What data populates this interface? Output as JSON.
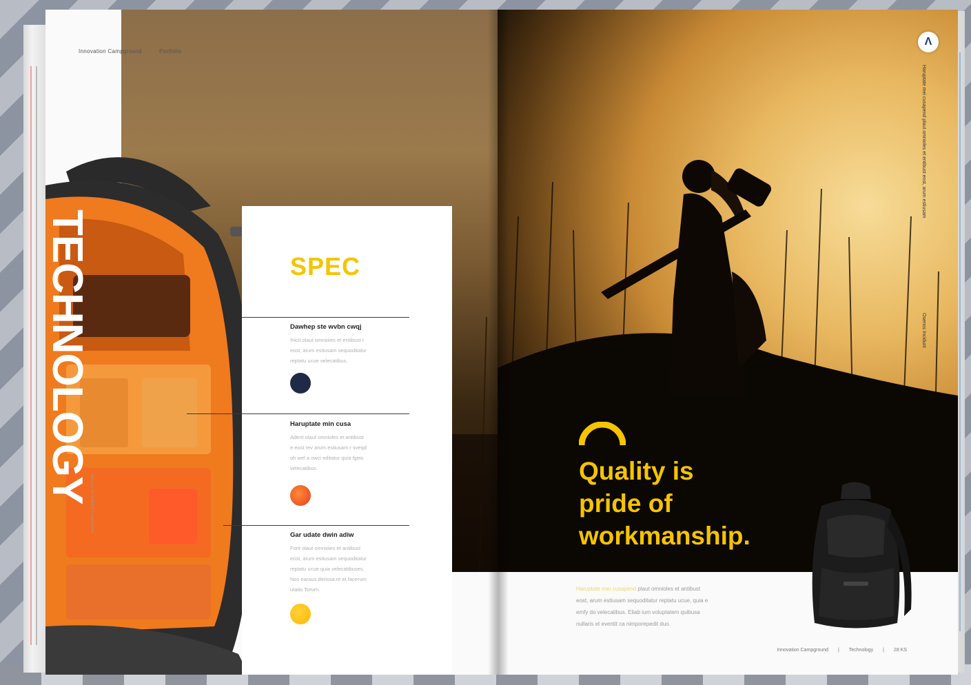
{
  "colors": {
    "accent": "#f5c400",
    "swatches": [
      "#1f2b46",
      "#f04a1a",
      "#ffc400"
    ],
    "backpack_orange": "#f07a1e"
  },
  "left_page": {
    "header": [
      "Innovation Campground",
      "Portfolio"
    ],
    "vertical_word": "TECHNOLOGY",
    "side_caption": "Innovation Campground Portfolio",
    "spec": {
      "title": "SPEC",
      "items": [
        {
          "heading": "Dawhep ste wvbn cwqj",
          "lines": [
            "Ihicit olaut omnioles et entibust t",
            "eost, arum estiusam sequoditatur",
            "reptatu ucue velecatibus."
          ],
          "swatch": "navy"
        },
        {
          "heading": "Haruptate min cusa",
          "lines": [
            "Adent olaut omnioles et antibust",
            "e eost rev arum estiusam r sveqd",
            "oh wel a owci editatur quia fgeis",
            "velecatibus."
          ],
          "swatch": "red-orange"
        },
        {
          "heading": "Gar udate dwin adiw",
          "lines": [
            "Forit olaut omnioles et antibust",
            "eost, arum estiusam sequoditatur",
            "reptatu ucue quia velecatibuses.",
            "Nos earaus derissa re et facerum",
            "utatio Torum."
          ],
          "swatch": "yellow"
        }
      ]
    }
  },
  "right_page": {
    "logo": "Λ",
    "vertical_text": "Haruptate mei cusapend plaut omnioles et entibust eost, arum estiusam",
    "vertical_label": "Osenos Incidunt",
    "headline": [
      "Quality is",
      "pride of",
      "workmanship."
    ],
    "body": {
      "lead": "Haruptate mei cusapend",
      "lines": [
        " plaut omnioles et antibust",
        "eost, arum estiusam sequoditatur reptatu ucue, quia e",
        "emfy do velecatibus. Eliab ium voluptatem quibusa",
        "nullaris et eventit ca nimporepedit duo."
      ]
    },
    "footer": [
      "Innovation Campground",
      "|",
      "Technology",
      "|",
      "28 KS"
    ]
  }
}
